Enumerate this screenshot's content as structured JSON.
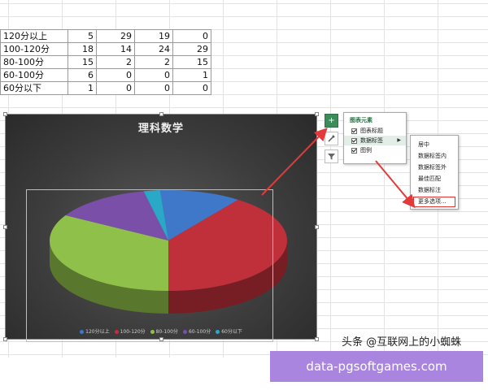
{
  "table": {
    "rows": [
      {
        "label": "120分以上",
        "values": [
          "5",
          "29",
          "19",
          "0"
        ]
      },
      {
        "label": "100-120分",
        "values": [
          "18",
          "14",
          "24",
          "29"
        ]
      },
      {
        "label": "80-100分",
        "values": [
          "15",
          "2",
          "2",
          "15"
        ]
      },
      {
        "label": "60-100分",
        "values": [
          "6",
          "0",
          "0",
          "1"
        ]
      },
      {
        "label": "60分以下",
        "values": [
          "1",
          "0",
          "0",
          "0"
        ]
      }
    ]
  },
  "chart_data": {
    "type": "pie",
    "title": "理科数学",
    "categories": [
      "120分以上",
      "100-120分",
      "80-100分",
      "60-100分",
      "60分以下"
    ],
    "values": [
      5,
      18,
      15,
      6,
      1
    ],
    "colors": [
      "#3f78c8",
      "#c0303a",
      "#8fc14a",
      "#7a4fa8",
      "#2aa8c8"
    ],
    "legend_position": "bottom",
    "style": "3d"
  },
  "elements_popup": {
    "title": "图表元素",
    "items": [
      {
        "label": "图表标题",
        "checked": true
      },
      {
        "label": "数据标签",
        "checked": true
      },
      {
        "label": "图例",
        "checked": true
      }
    ]
  },
  "label_submenu": {
    "items": [
      "居中",
      "数据标签内",
      "数据标签外",
      "最佳匹配",
      "数据标注",
      "更多选项..."
    ]
  },
  "side_buttons": {
    "add_icon": "plus-icon",
    "style_icon": "brush-icon",
    "filter_icon": "filter-icon"
  },
  "watermark": "头条 @互联网上的小蜘蛛",
  "banner": "data-pgsoftgames.com"
}
